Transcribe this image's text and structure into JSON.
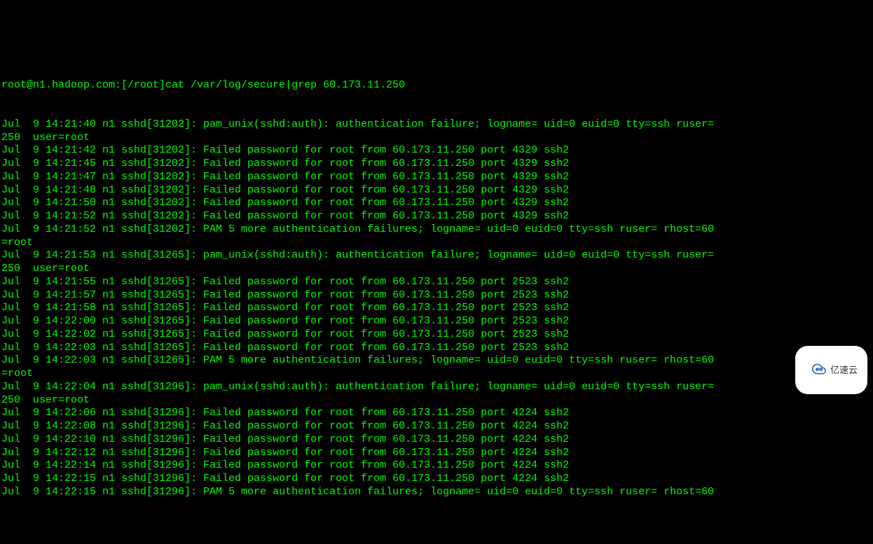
{
  "prompt": "root@n1.hadoop.com:[/root]cat /var/log/secure|grep 60.173.11.250",
  "lines": [
    "Jul  9 14:21:40 n1 sshd[31202]: pam_unix(sshd:auth): authentication failure; logname= uid=0 euid=0 tty=ssh ruser=",
    "250  user=root",
    "Jul  9 14:21:42 n1 sshd[31202]: Failed password for root from 60.173.11.250 port 4329 ssh2",
    "Jul  9 14:21:45 n1 sshd[31202]: Failed password for root from 60.173.11.250 port 4329 ssh2",
    "Jul  9 14:21:47 n1 sshd[31202]: Failed password for root from 60.173.11.250 port 4329 ssh2",
    "Jul  9 14:21:48 n1 sshd[31202]: Failed password for root from 60.173.11.250 port 4329 ssh2",
    "Jul  9 14:21:50 n1 sshd[31202]: Failed password for root from 60.173.11.250 port 4329 ssh2",
    "Jul  9 14:21:52 n1 sshd[31202]: Failed password for root from 60.173.11.250 port 4329 ssh2",
    "Jul  9 14:21:52 n1 sshd[31202]: PAM 5 more authentication failures; logname= uid=0 euid=0 tty=ssh ruser= rhost=60",
    "=root",
    "Jul  9 14:21:53 n1 sshd[31265]: pam_unix(sshd:auth): authentication failure; logname= uid=0 euid=0 tty=ssh ruser=",
    "250  user=root",
    "Jul  9 14:21:55 n1 sshd[31265]: Failed password for root from 60.173.11.250 port 2523 ssh2",
    "Jul  9 14:21:57 n1 sshd[31265]: Failed password for root from 60.173.11.250 port 2523 ssh2",
    "Jul  9 14:21:58 n1 sshd[31265]: Failed password for root from 60.173.11.250 port 2523 ssh2",
    "Jul  9 14:22:00 n1 sshd[31265]: Failed password for root from 60.173.11.250 port 2523 ssh2",
    "Jul  9 14:22:02 n1 sshd[31265]: Failed password for root from 60.173.11.250 port 2523 ssh2",
    "Jul  9 14:22:03 n1 sshd[31265]: Failed password for root from 60.173.11.250 port 2523 ssh2",
    "Jul  9 14:22:03 n1 sshd[31265]: PAM 5 more authentication failures; logname= uid=0 euid=0 tty=ssh ruser= rhost=60",
    "=root",
    "Jul  9 14:22:04 n1 sshd[31296]: pam_unix(sshd:auth): authentication failure; logname= uid=0 euid=0 tty=ssh ruser=",
    "250  user=root",
    "Jul  9 14:22:06 n1 sshd[31296]: Failed password for root from 60.173.11.250 port 4224 ssh2",
    "Jul  9 14:22:08 n1 sshd[31296]: Failed password for root from 60.173.11.250 port 4224 ssh2",
    "Jul  9 14:22:10 n1 sshd[31296]: Failed password for root from 60.173.11.250 port 4224 ssh2",
    "Jul  9 14:22:12 n1 sshd[31296]: Failed password for root from 60.173.11.250 port 4224 ssh2",
    "Jul  9 14:22:14 n1 sshd[31296]: Failed password for root from 60.173.11.250 port 4224 ssh2",
    "Jul  9 14:22:15 n1 sshd[31296]: Failed password for root from 60.173.11.250 port 4224 ssh2",
    "Jul  9 14:22:15 n1 sshd[31296]: PAM 5 more authentication failures; logname= uid=0 euid=0 tty=ssh ruser= rhost=60"
  ],
  "watermark": {
    "text": "亿速云",
    "icon": "cloud-logo-icon"
  }
}
